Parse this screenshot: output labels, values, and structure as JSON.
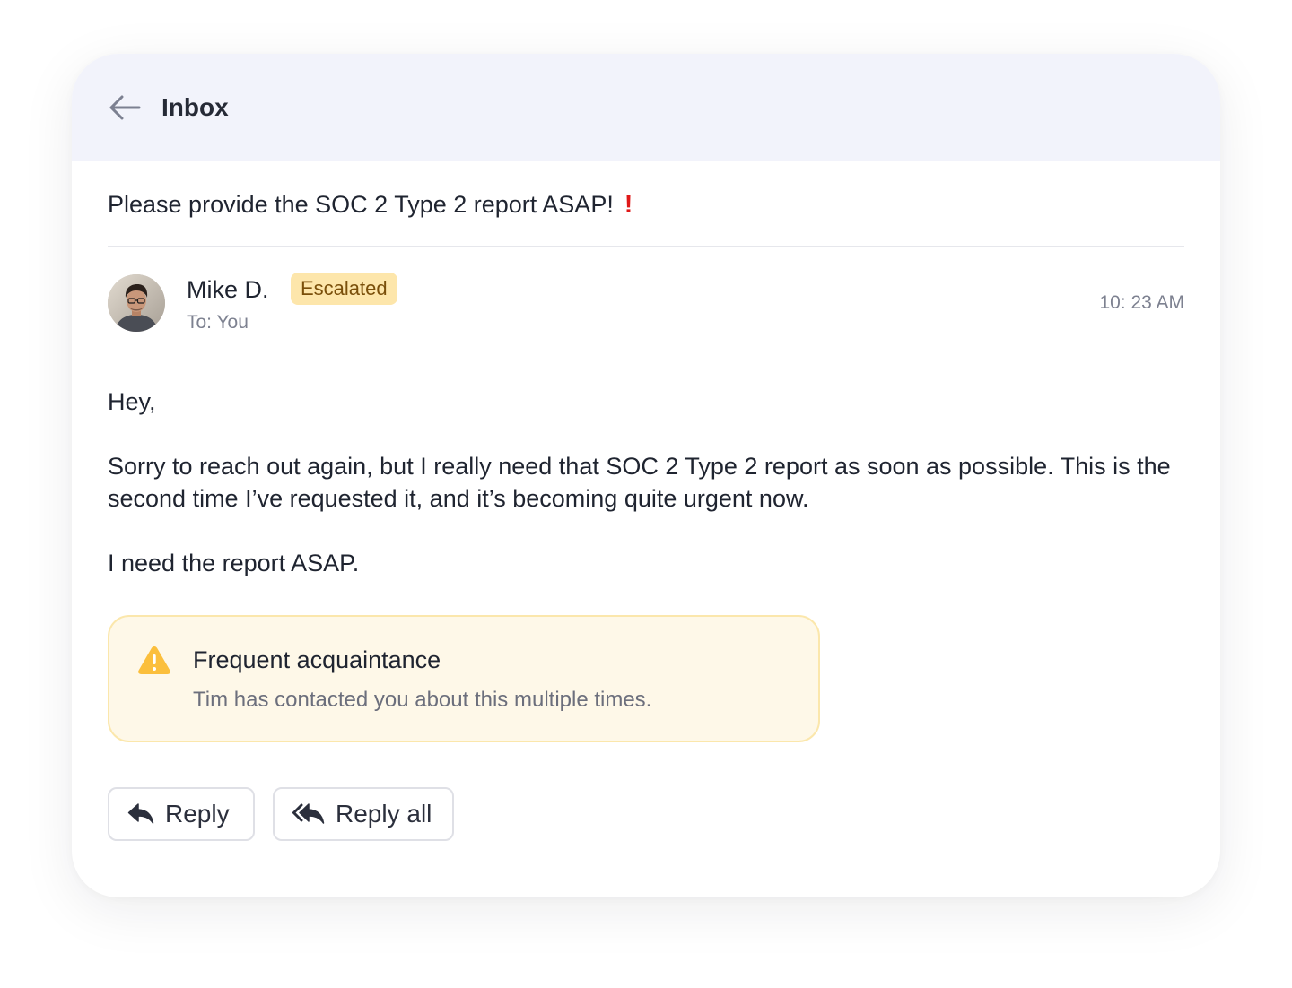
{
  "header": {
    "title": "Inbox",
    "back_icon": "arrow-left-icon"
  },
  "email": {
    "subject": "Please provide the SOC 2 Type 2 report ASAP!",
    "subject_mark": "!",
    "sender": {
      "name": "Mike D.",
      "badge": "Escalated",
      "recipient": "To: You",
      "avatar": "avatar-photo"
    },
    "time": "10: 23 AM",
    "body": [
      "Hey,",
      "Sorry to reach out again, but I really need that SOC 2 Type 2 report as soon as possible. This is the second time I’ve requested it, and it’s becoming quite urgent now.",
      "I need the report ASAP."
    ]
  },
  "alert": {
    "icon": "warning-icon",
    "title": "Frequent acquaintance",
    "text": "Tim has contacted you about this multiple times."
  },
  "actions": {
    "reply_label": "Reply",
    "reply_icon": "reply-icon",
    "reply_all_label": "Reply all",
    "reply_all_icon": "reply-all-icon"
  },
  "colors": {
    "header_bg": "#f2f3fb",
    "badge_bg": "#fde6ab",
    "alert_bg": "#fef8e8",
    "alert_border": "#fbe7ac",
    "warning": "#fbbf3c",
    "urgent": "#e01818"
  }
}
